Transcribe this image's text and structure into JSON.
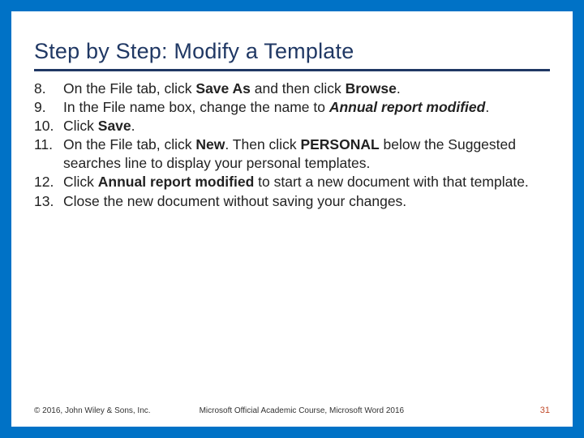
{
  "title": "Step by Step: Modify a Template",
  "steps": [
    {
      "num": "8.",
      "parts": [
        {
          "t": "On the File tab, click "
        },
        {
          "t": "Save As",
          "cls": "b"
        },
        {
          "t": " and then click "
        },
        {
          "t": "Browse",
          "cls": "b"
        },
        {
          "t": "."
        }
      ]
    },
    {
      "num": "9.",
      "parts": [
        {
          "t": "In the File name box, change the name to "
        },
        {
          "t": "Annual report modified",
          "cls": "bi"
        },
        {
          "t": "."
        }
      ]
    },
    {
      "num": "10.",
      "parts": [
        {
          "t": "Click "
        },
        {
          "t": "Save",
          "cls": "b"
        },
        {
          "t": "."
        }
      ]
    },
    {
      "num": "11.",
      "parts": [
        {
          "t": "On the File tab, click "
        },
        {
          "t": "New",
          "cls": "b"
        },
        {
          "t": ". Then click "
        },
        {
          "t": "PERSONAL",
          "cls": "b"
        },
        {
          "t": " below the Suggested searches line to display your personal templates."
        }
      ]
    },
    {
      "num": "12.",
      "parts": [
        {
          "t": "Click "
        },
        {
          "t": "Annual report modified",
          "cls": "b"
        },
        {
          "t": " to start a new document with that template."
        }
      ]
    },
    {
      "num": "13.",
      "parts": [
        {
          "t": "Close the new document without saving your changes."
        }
      ]
    }
  ],
  "footer": {
    "copyright": "© 2016, John Wiley & Sons, Inc.",
    "course": "Microsoft Official Academic Course, Microsoft Word 2016",
    "page": "31"
  }
}
